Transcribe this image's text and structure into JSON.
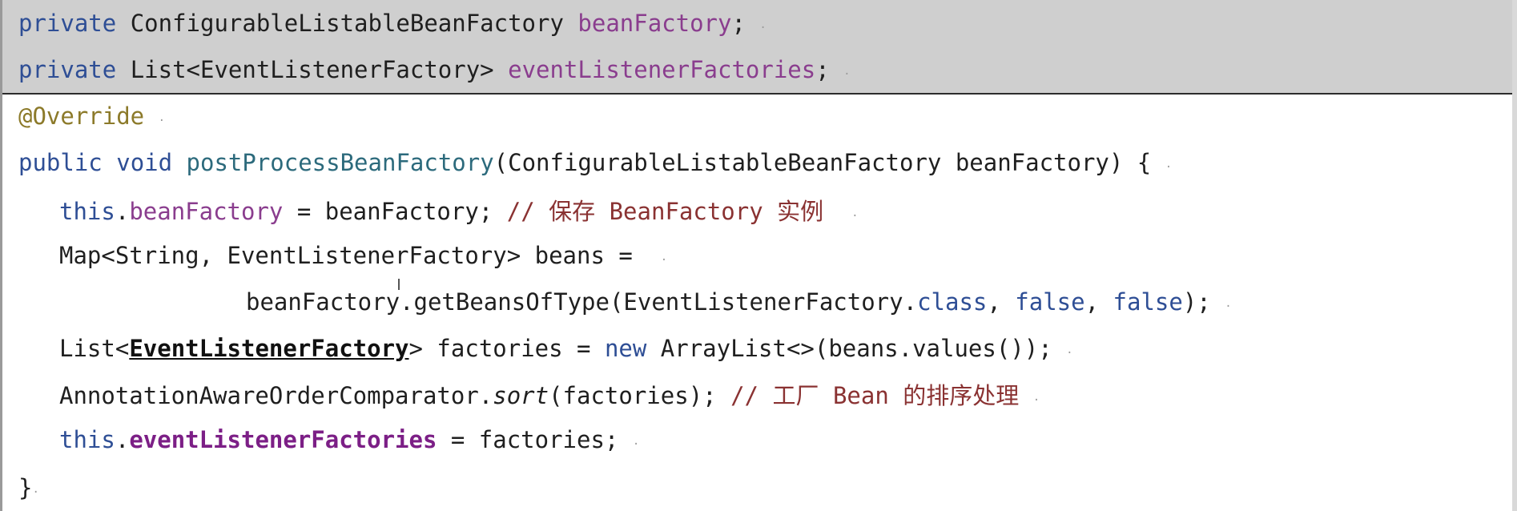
{
  "code": {
    "line1": {
      "kw": "private",
      "type": "ConfigurableListableBeanFactory",
      "field": "beanFactory",
      "end": ";"
    },
    "line2": {
      "kw": "private",
      "type": "List<EventListenerFactory>",
      "field": "eventListenerFactories",
      "end": ";"
    },
    "line3": {
      "annotation": "@Override"
    },
    "line4": {
      "kw1": "public",
      "kw2": "void",
      "method": "postProcessBeanFactory",
      "params": "(ConfigurableListableBeanFactory beanFactory) {"
    },
    "line5": {
      "kw": "this",
      "dot": ".",
      "field": "beanFactory",
      "rest": " = beanFactory; ",
      "comment_a": "// ",
      "comment_cjk1": "保存",
      "comment_b": " BeanFactory ",
      "comment_cjk2": "实例"
    },
    "line6": {
      "text": "Map<String, EventListenerFactory> beans ="
    },
    "line7": {
      "pre": "beanFactory.getBeansOfType(EventListenerFactory.",
      "kw_class": "class",
      "sep1": ", ",
      "kw_false1": "false",
      "sep2": ", ",
      "kw_false2": "false",
      "end": ");"
    },
    "line8": {
      "pre": "List<",
      "type_link": "EventListenerFactory",
      "mid": "> factories = ",
      "kw_new": "new",
      "post": " ArrayList<>(beans.values());"
    },
    "line9": {
      "pre": "AnnotationAwareOrderComparator.",
      "method_italic": "sort",
      "post": "(factories); ",
      "comment_a": "// ",
      "comment_cjk1": "工厂",
      "comment_b": " Bean ",
      "comment_cjk2": "的排序处理"
    },
    "line10": {
      "kw": "this",
      "dot": ".",
      "field": "eventListenerFactories",
      "rest": " = factories;"
    },
    "line11": {
      "text": "}"
    }
  },
  "whitespace_marker": "·",
  "colors": {
    "keyword": "#2e4e95",
    "field": "#8a3d8e",
    "method": "#2c6a7c",
    "annotation": "#8c7a2a",
    "comment": "#8a3232",
    "header_band": "#cfcfcf"
  }
}
